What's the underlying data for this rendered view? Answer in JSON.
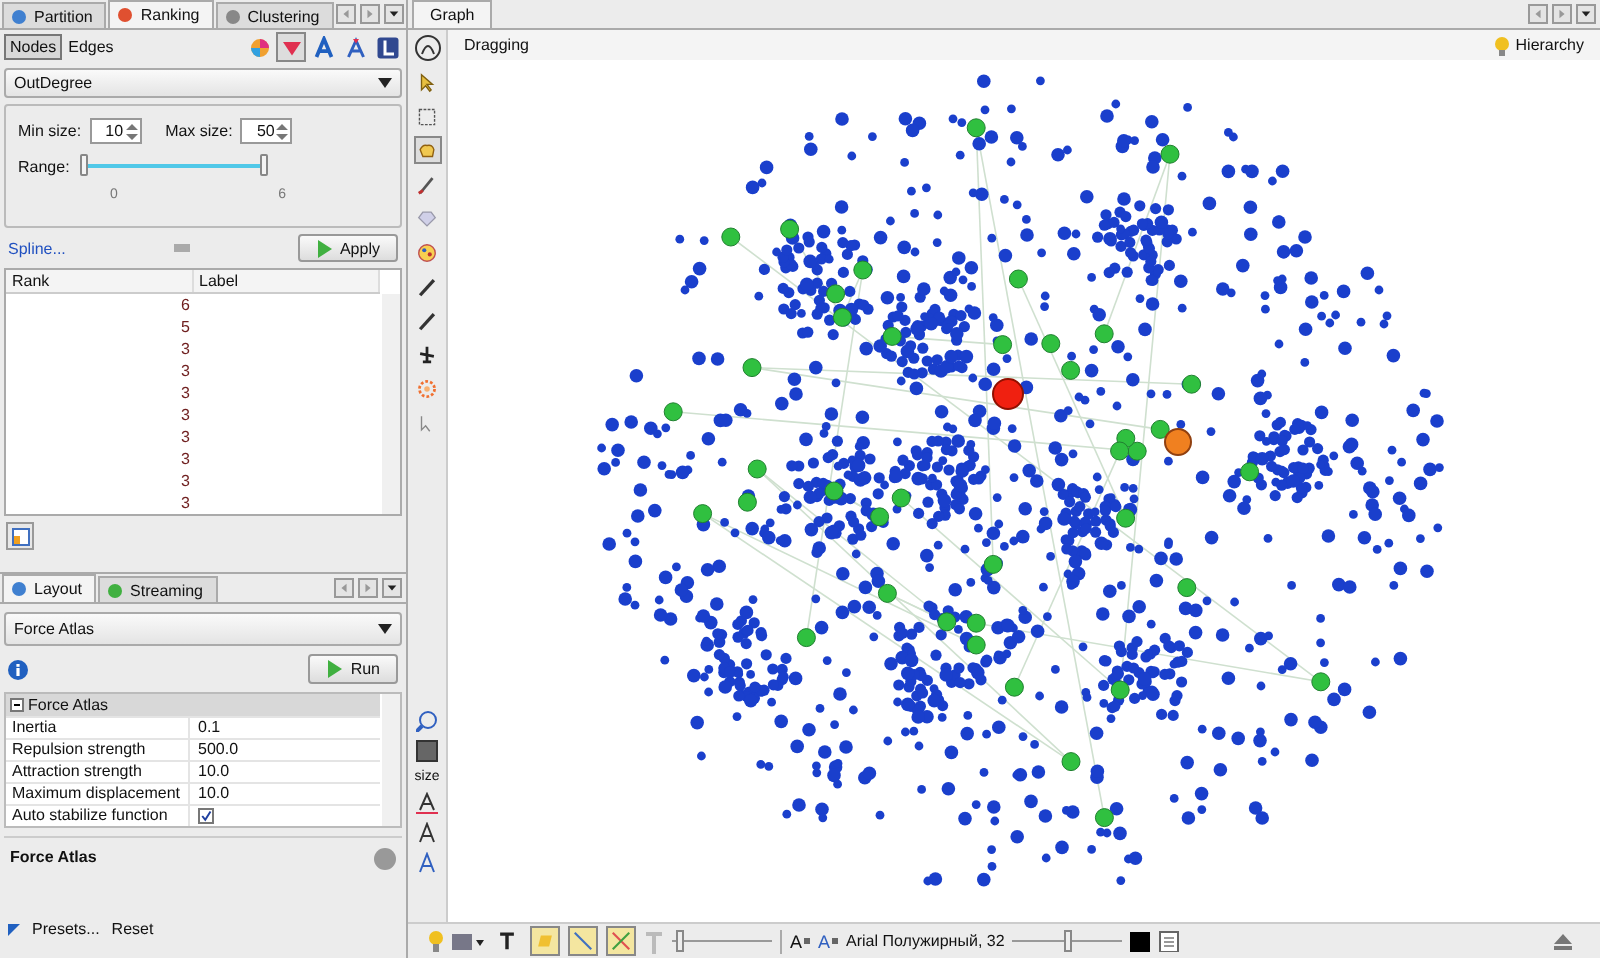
{
  "top_tabs": [
    {
      "label": "Partition",
      "selected": false
    },
    {
      "label": "Ranking",
      "selected": true
    },
    {
      "label": "Clustering",
      "selected": false
    }
  ],
  "ranking": {
    "subtabs": [
      {
        "label": "Nodes",
        "selected": true
      },
      {
        "label": "Edges",
        "selected": false
      }
    ],
    "tools": [
      {
        "kind": "color",
        "selected": false
      },
      {
        "kind": "size",
        "selected": true
      },
      {
        "kind": "label-color",
        "selected": false
      },
      {
        "kind": "label-size",
        "selected": false
      },
      {
        "kind": "settings",
        "selected": false
      }
    ],
    "attribute": "OutDegree",
    "min_size_label": "Min size:",
    "min_size": "10",
    "max_size_label": "Max size:",
    "max_size": "50",
    "range_label": "Range:",
    "range_slider": {
      "level": 1
    },
    "range_min": "0",
    "range_max": "6",
    "spline_link": "Spline...",
    "apply_button": "Apply",
    "table": {
      "columns": [
        "Rank",
        "Label"
      ],
      "rows": [
        "6",
        "5",
        "3",
        "3",
        "3",
        "3",
        "3",
        "3",
        "3",
        "3"
      ]
    }
  },
  "layout": {
    "tabs": [
      {
        "label": "Layout",
        "selected": true
      },
      {
        "label": "Streaming",
        "selected": false
      }
    ],
    "algorithm": "Force Atlas",
    "run_button": "Run",
    "section": {
      "title": "Force Atlas",
      "expanded": true
    },
    "properties": [
      {
        "kind": "text",
        "name": "Inertia",
        "value": "0.1"
      },
      {
        "kind": "text",
        "name": "Repulsion strength",
        "value": "500.0"
      },
      {
        "kind": "text",
        "name": "Attraction strength",
        "value": "10.0"
      },
      {
        "kind": "text",
        "name": "Maximum displacement",
        "value": "10.0"
      },
      {
        "kind": "checkbox",
        "name": "Auto stabilize function",
        "checked": true
      }
    ],
    "description_title": "Force Atlas",
    "presets": "Presets...",
    "reset": "Reset"
  },
  "graph": {
    "tab": "Graph",
    "mode": "Dragging",
    "hierarchy": "Hierarchy",
    "tools": [
      {
        "kind": "select",
        "selected": false
      },
      {
        "kind": "rect",
        "selected": false
      },
      {
        "kind": "drag",
        "selected": true
      },
      {
        "kind": "brush",
        "selected": false
      },
      {
        "kind": "diamond",
        "selected": false
      },
      {
        "kind": "palette",
        "selected": false
      },
      {
        "kind": "pencil",
        "selected": false
      },
      {
        "kind": "pencil",
        "selected": false
      },
      {
        "kind": "plane",
        "selected": false
      },
      {
        "kind": "flower",
        "selected": false
      },
      {
        "kind": "help",
        "selected": false
      }
    ],
    "side_label": "size",
    "bottom_tools": [
      {
        "kind": "text",
        "selected": false
      },
      {
        "kind": "label",
        "selected": true
      },
      {
        "kind": "edge",
        "selected": true
      },
      {
        "kind": "edge-color",
        "selected": true
      }
    ],
    "edge_slider": {
      "level": 0.05
    },
    "font_buttons": [
      "A",
      "A"
    ],
    "font": "Arial Полужирный, 32",
    "font_slider": {
      "level": 0.5
    }
  }
}
